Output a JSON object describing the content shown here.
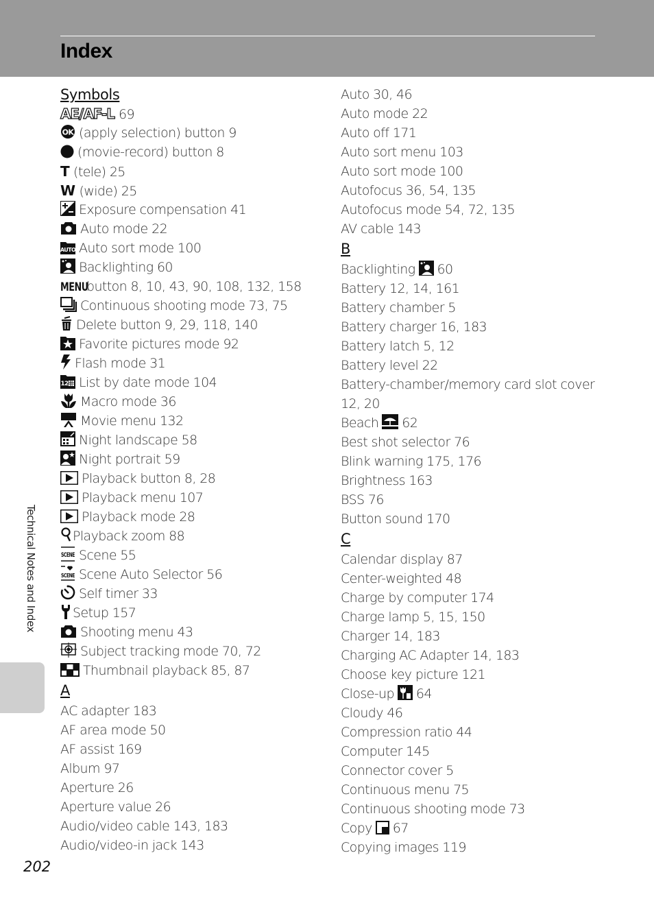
{
  "header": {
    "title": "Index"
  },
  "sidebar": {
    "section_label": "Technical Notes and Index"
  },
  "footer": {
    "page_number": "202"
  },
  "left_column": {
    "symbols_heading": "Symbols",
    "symbols": [
      {
        "icon": "ae-af-l-icon",
        "icon_text": "AE/AF-L",
        "text": "69"
      },
      {
        "icon": "ok-button-icon",
        "text": "(apply selection) button 9"
      },
      {
        "icon": "movie-record-icon",
        "text": "(movie-record) button 8"
      },
      {
        "icon": "tele-icon",
        "icon_text": "T",
        "text": "(tele) 25"
      },
      {
        "icon": "wide-icon",
        "icon_text": "W",
        "text": "(wide) 25"
      },
      {
        "icon": "exposure-compensation-icon",
        "text": "Exposure compensation 41"
      },
      {
        "icon": "camera-icon",
        "text": "Auto mode 22"
      },
      {
        "icon": "auto-sort-icon",
        "text": "Auto sort mode 100"
      },
      {
        "icon": "backlighting-icon",
        "text": "Backlighting 60"
      },
      {
        "icon": "menu-icon",
        "icon_text": "MENU",
        "text": "button 8, 10, 43, 90, 108, 132, 158"
      },
      {
        "icon": "continuous-shooting-icon",
        "text": "Continuous shooting mode 73, 75"
      },
      {
        "icon": "trash-icon",
        "text": "Delete button 9, 29, 118, 140"
      },
      {
        "icon": "favorite-star-icon",
        "text": "Favorite pictures mode 92"
      },
      {
        "icon": "flash-icon",
        "text": "Flash mode 31"
      },
      {
        "icon": "list-by-date-icon",
        "text": "List by date mode 104"
      },
      {
        "icon": "macro-flower-icon",
        "text": "Macro mode 36"
      },
      {
        "icon": "movie-camera-icon",
        "text": "Movie menu 132"
      },
      {
        "icon": "night-landscape-icon",
        "text": "Night landscape 58"
      },
      {
        "icon": "night-portrait-icon",
        "text": "Night portrait 59"
      },
      {
        "icon": "playback-icon",
        "text": "Playback button 8, 28"
      },
      {
        "icon": "playback-icon",
        "text": "Playback menu 107"
      },
      {
        "icon": "playback-icon",
        "text": "Playback mode 28"
      },
      {
        "icon": "zoom-magnifier-icon",
        "text": "Playback zoom 88"
      },
      {
        "icon": "scene-icon",
        "text": "Scene 55"
      },
      {
        "icon": "scene-auto-selector-icon",
        "text": "Scene Auto Selector 56"
      },
      {
        "icon": "self-timer-icon",
        "text": "Self timer 33"
      },
      {
        "icon": "setup-wrench-icon",
        "text": "Setup 157"
      },
      {
        "icon": "camera-icon",
        "text": "Shooting menu 43"
      },
      {
        "icon": "subject-tracking-icon",
        "text": "Subject tracking mode 70, 72"
      },
      {
        "icon": "thumbnail-grid-icon",
        "text": "Thumbnail playback 85, 87"
      }
    ],
    "a_heading": "A",
    "a_entries": [
      "AC adapter 183",
      "AF area mode 50",
      "AF assist 169",
      "Album 97",
      "Aperture 26",
      "Aperture value 26",
      "Audio/video cable 143, 183",
      "Audio/video-in jack 143"
    ]
  },
  "right_column": {
    "a_entries": [
      "Auto 30, 46",
      "Auto mode 22",
      "Auto off 171",
      "Auto sort menu 103",
      "Auto sort mode 100",
      "Autofocus 36, 54, 135",
      "Autofocus mode 54, 72, 135",
      "AV cable 143"
    ],
    "b_heading": "B",
    "b_entries": [
      {
        "pre": "Backlighting",
        "icon": "backlighting-icon",
        "post": "60"
      },
      {
        "text": "Battery 12, 14, 161"
      },
      {
        "text": "Battery chamber 5"
      },
      {
        "text": "Battery charger 16, 183"
      },
      {
        "text": "Battery latch 5, 12"
      },
      {
        "text": "Battery level 22"
      },
      {
        "text": "Battery-chamber/memory card slot cover"
      },
      {
        "text": "12, 20"
      },
      {
        "pre": "Beach",
        "icon": "beach-icon",
        "post": "62"
      },
      {
        "text": "Best shot selector 76"
      },
      {
        "text": "Blink warning 175, 176"
      },
      {
        "text": "Brightness 163"
      },
      {
        "text": "BSS 76"
      },
      {
        "text": "Button sound 170"
      }
    ],
    "c_heading": "C",
    "c_entries": [
      {
        "text": "Calendar display 87"
      },
      {
        "text": "Center-weighted 48"
      },
      {
        "text": "Charge by computer 174"
      },
      {
        "text": "Charge lamp 5, 15, 150"
      },
      {
        "text": "Charger 14, 183"
      },
      {
        "text": "Charging AC Adapter 14, 183"
      },
      {
        "text": "Choose key picture 121"
      },
      {
        "pre": "Close-up",
        "icon": "close-up-icon",
        "post": "64"
      },
      {
        "text": "Cloudy 46"
      },
      {
        "text": "Compression ratio 44"
      },
      {
        "text": "Computer 145"
      },
      {
        "text": "Connector cover 5"
      },
      {
        "text": "Continuous menu 75"
      },
      {
        "text": "Continuous shooting mode 73"
      },
      {
        "pre": "Copy",
        "icon": "copy-icon",
        "post": "67"
      },
      {
        "text": "Copying images 119"
      }
    ]
  }
}
